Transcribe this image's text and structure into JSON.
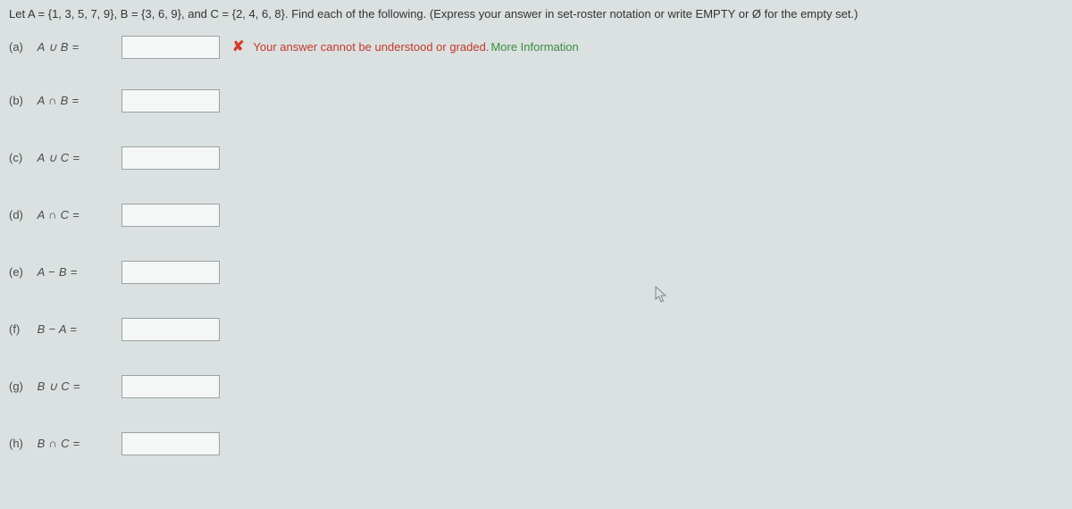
{
  "prompt": {
    "lead": "Let ",
    "setsText": "A = {1, 3, 5, 7, 9}, B = {3, 6, 9}, and C = {2, 4, 6, 8}.",
    "tail": " Find each of the following. (Express your answer in set-roster notation or write EMPTY or Ø for the empty set.)"
  },
  "error": {
    "message": "Your answer cannot be understood or graded. ",
    "moreInfo": "More Information"
  },
  "parts": [
    {
      "label": "(a)",
      "expr": "A ∪ B =",
      "hasError": true,
      "value": ""
    },
    {
      "label": "(b)",
      "expr": "A ∩ B =",
      "hasError": false,
      "value": ""
    },
    {
      "label": "(c)",
      "expr": "A ∪ C =",
      "hasError": false,
      "value": ""
    },
    {
      "label": "(d)",
      "expr": "A ∩ C =",
      "hasError": false,
      "value": ""
    },
    {
      "label": "(e)",
      "expr": "A − B =",
      "hasError": false,
      "value": ""
    },
    {
      "label": "(f)",
      "expr": "B − A =",
      "hasError": false,
      "value": ""
    },
    {
      "label": "(g)",
      "expr": "B ∪ C =",
      "hasError": false,
      "value": ""
    },
    {
      "label": "(h)",
      "expr": "B ∩ C =",
      "hasError": false,
      "value": ""
    }
  ]
}
